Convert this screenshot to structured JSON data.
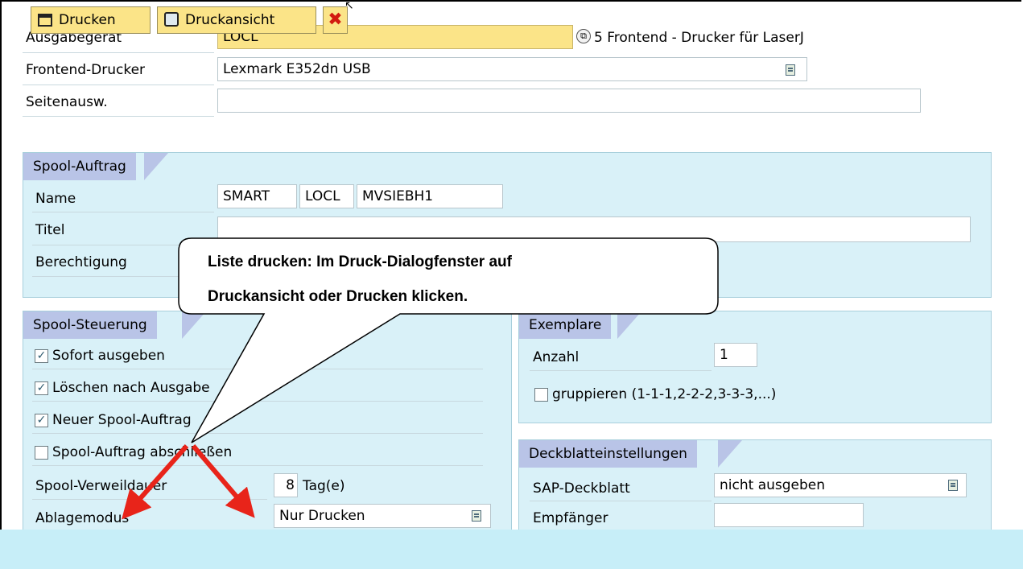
{
  "header": {
    "ausgabegeraet_label": "Ausgabegerät",
    "ausgabegeraet_value": "LOCL",
    "ausgabegeraet_desc": "5  Frontend - Drucker für LaserJ",
    "frontend_drucker_label": "Frontend-Drucker",
    "frontend_drucker_value": "Lexmark E352dn USB",
    "seitenausw_label": "Seitenausw.",
    "seitenausw_value": ""
  },
  "spool_auftrag": {
    "title": "Spool-Auftrag",
    "name_label": "Name",
    "name_values": [
      "SMART",
      "LOCL",
      "MVSIEBH1"
    ],
    "titel_label": "Titel",
    "titel_value": "",
    "berechtigung_label": "Berechtigung"
  },
  "spool_steuerung": {
    "title": "Spool-Steuerung",
    "checkboxes": [
      {
        "label": "Sofort ausgeben",
        "checked": true
      },
      {
        "label": "Löschen nach Ausgabe",
        "checked": true
      },
      {
        "label": "Neuer Spool-Auftrag",
        "checked": true
      },
      {
        "label": "Spool-Auftrag abschließen",
        "checked": false
      }
    ],
    "verweildauer_label": "Spool-Verweildauer",
    "verweildauer_value": "8",
    "verweildauer_unit": "Tag(e)",
    "ablagemodus_label": "Ablagemodus",
    "ablagemodus_value": "Nur Drucken"
  },
  "exemplare": {
    "title": "Exemplare",
    "anzahl_label": "Anzahl",
    "anzahl_value": "1",
    "gruppieren_label": "gruppieren (1-1-1,2-2-2,3-3-3,...)",
    "gruppieren_checked": false
  },
  "deckblatt": {
    "title": "Deckblatteinstellungen",
    "sap_deckblatt_label": "SAP-Deckblatt",
    "sap_deckblatt_value": "nicht ausgeben",
    "empfaenger_label": "Empfänger",
    "empfaenger_value": ""
  },
  "callout": {
    "line1": "Liste drucken: Im Druck-Dialogfenster auf",
    "line2": "Druckansicht oder Drucken klicken."
  },
  "toolbar": {
    "drucken_label": "Drucken",
    "druckansicht_label": "Druckansicht"
  },
  "colors": {
    "group_bg": "#d9f1f8",
    "tab_bg": "#b9c4e7",
    "highlight_field": "#fbe488",
    "arrow_red": "#e8241a",
    "toolbar_bg": "#c7eef8"
  }
}
